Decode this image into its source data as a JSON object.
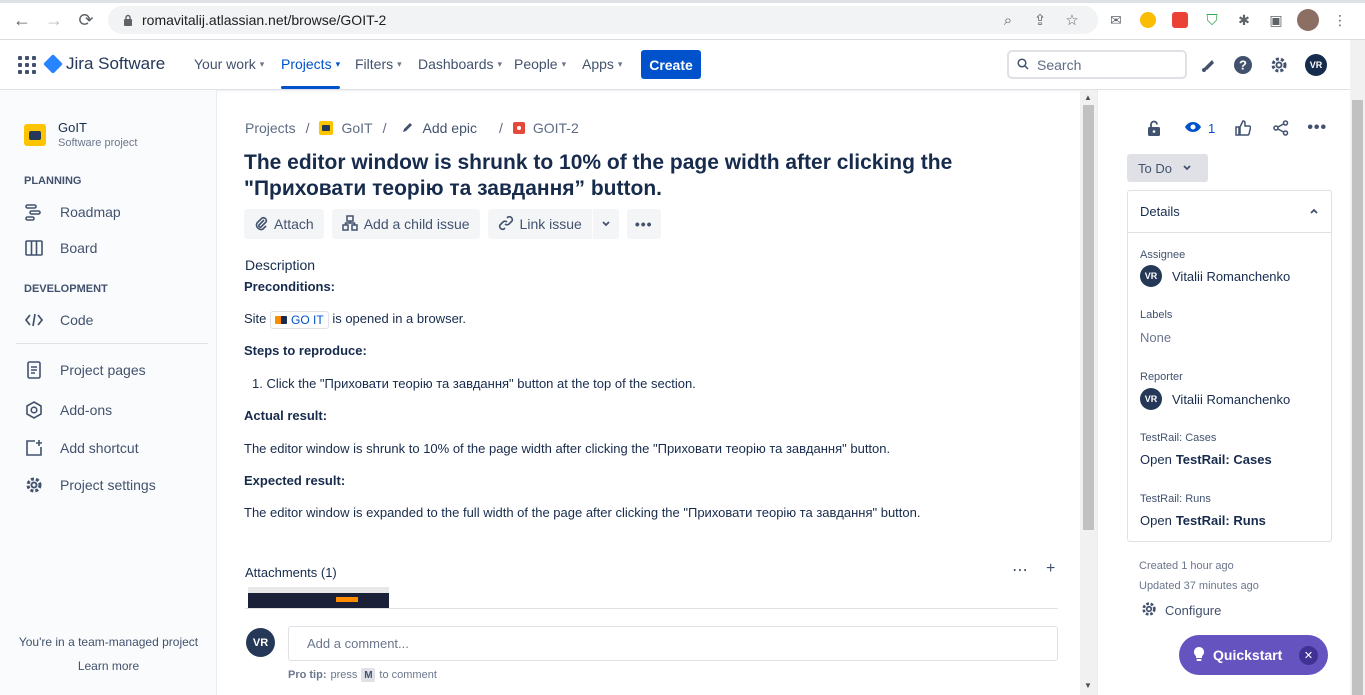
{
  "browser": {
    "url": "romavitalij.atlassian.net/browse/GOIT-2"
  },
  "topnav": {
    "brand": "Jira Software",
    "menus": [
      {
        "label": "Your work"
      },
      {
        "label": "Projects"
      },
      {
        "label": "Filters"
      },
      {
        "label": "Dashboards"
      },
      {
        "label": "People"
      },
      {
        "label": "Apps"
      }
    ],
    "create_label": "Create",
    "search_placeholder": "Search",
    "user_initials": "VR"
  },
  "sidebar": {
    "project_name": "GoIT",
    "project_type": "Software project",
    "planning_title": "PLANNING",
    "roadmap": "Roadmap",
    "board": "Board",
    "development_title": "DEVELOPMENT",
    "code": "Code",
    "project_pages": "Project pages",
    "addons": "Add-ons",
    "add_shortcut": "Add shortcut",
    "project_settings": "Project settings",
    "footer_text": "You're in a team-managed project",
    "learn_more": "Learn more"
  },
  "issue": {
    "breadcrumb": {
      "projects": "Projects",
      "project": "GoIT",
      "epic": "Add epic",
      "key": "GOIT-2"
    },
    "title": "The editor window is shrunk to 10% of the page width after clicking the \"Приховати теорію та завдання” button.",
    "actions": {
      "attach": "Attach",
      "child": "Add a child issue",
      "link": "Link issue"
    },
    "description_label": "Description",
    "preconditions_heading": "Preconditions:",
    "site_prefix": "Site",
    "site_link": "GO IT",
    "site_suffix": "is opened in a browser.",
    "steps_heading": "Steps to reproduce:",
    "step1": "1. Click the \"Приховати теорію та завдання\" button at the top of the section.",
    "actual_heading": "Actual result:",
    "actual_text": "The editor window is shrunk to 10% of the page width after clicking the \"Приховати теорію та завдання\" button.",
    "expected_heading": "Expected result:",
    "expected_text": "The editor window is expanded to the full width of the page after clicking the \"Приховати теорію та завдання\" button.",
    "attachments_title": "Attachments (1)",
    "comment_avatar": "VR",
    "comment_placeholder": "Add a comment...",
    "protip_label": "Pro tip:",
    "protip_press": "press",
    "protip_key": "M",
    "protip_suffix": "to comment"
  },
  "right": {
    "watch_count": "1",
    "status": "To Do",
    "details_title": "Details",
    "assignee_label": "Assignee",
    "assignee": "Vitalii Romanchenko",
    "assignee_initials": "VR",
    "labels_label": "Labels",
    "labels_value": "None",
    "reporter_label": "Reporter",
    "reporter": "Vitalii Romanchenko",
    "reporter_initials": "VR",
    "tr_cases_label": "TestRail: Cases",
    "tr_cases_prefix": "Open",
    "tr_cases_value": "TestRail: Cases",
    "tr_runs_label": "TestRail: Runs",
    "tr_runs_prefix": "Open",
    "tr_runs_value": "TestRail: Runs",
    "created": "Created 1 hour ago",
    "updated": "Updated 37 minutes ago",
    "configure": "Configure",
    "quickstart": "Quickstart"
  }
}
